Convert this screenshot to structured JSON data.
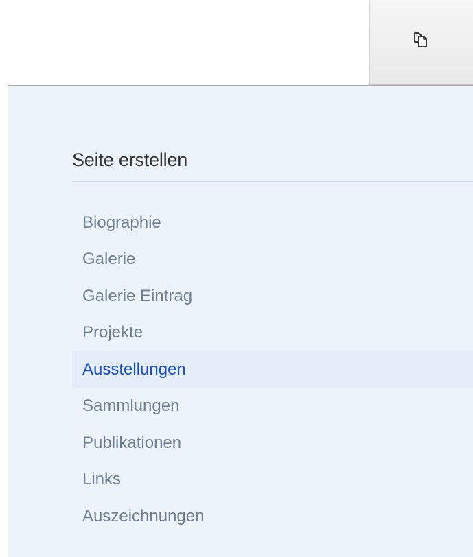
{
  "toolbar": {
    "copy_button_icon": "copy-pages-icon"
  },
  "panel": {
    "heading": "Seite erstellen",
    "items": [
      {
        "label": "Biographie"
      },
      {
        "label": "Galerie"
      },
      {
        "label": "Galerie Eintrag"
      },
      {
        "label": "Projekte"
      },
      {
        "label": "Ausstellungen",
        "active": true
      },
      {
        "label": "Sammlungen"
      },
      {
        "label": "Publikationen"
      },
      {
        "label": "Links"
      },
      {
        "label": "Auszeichnungen"
      }
    ]
  },
  "colors": {
    "panel_bg": "#ecf3fb",
    "item_text": "#6f7f91",
    "active_text": "#1a4fb5",
    "active_bg": "#e4edf7"
  }
}
